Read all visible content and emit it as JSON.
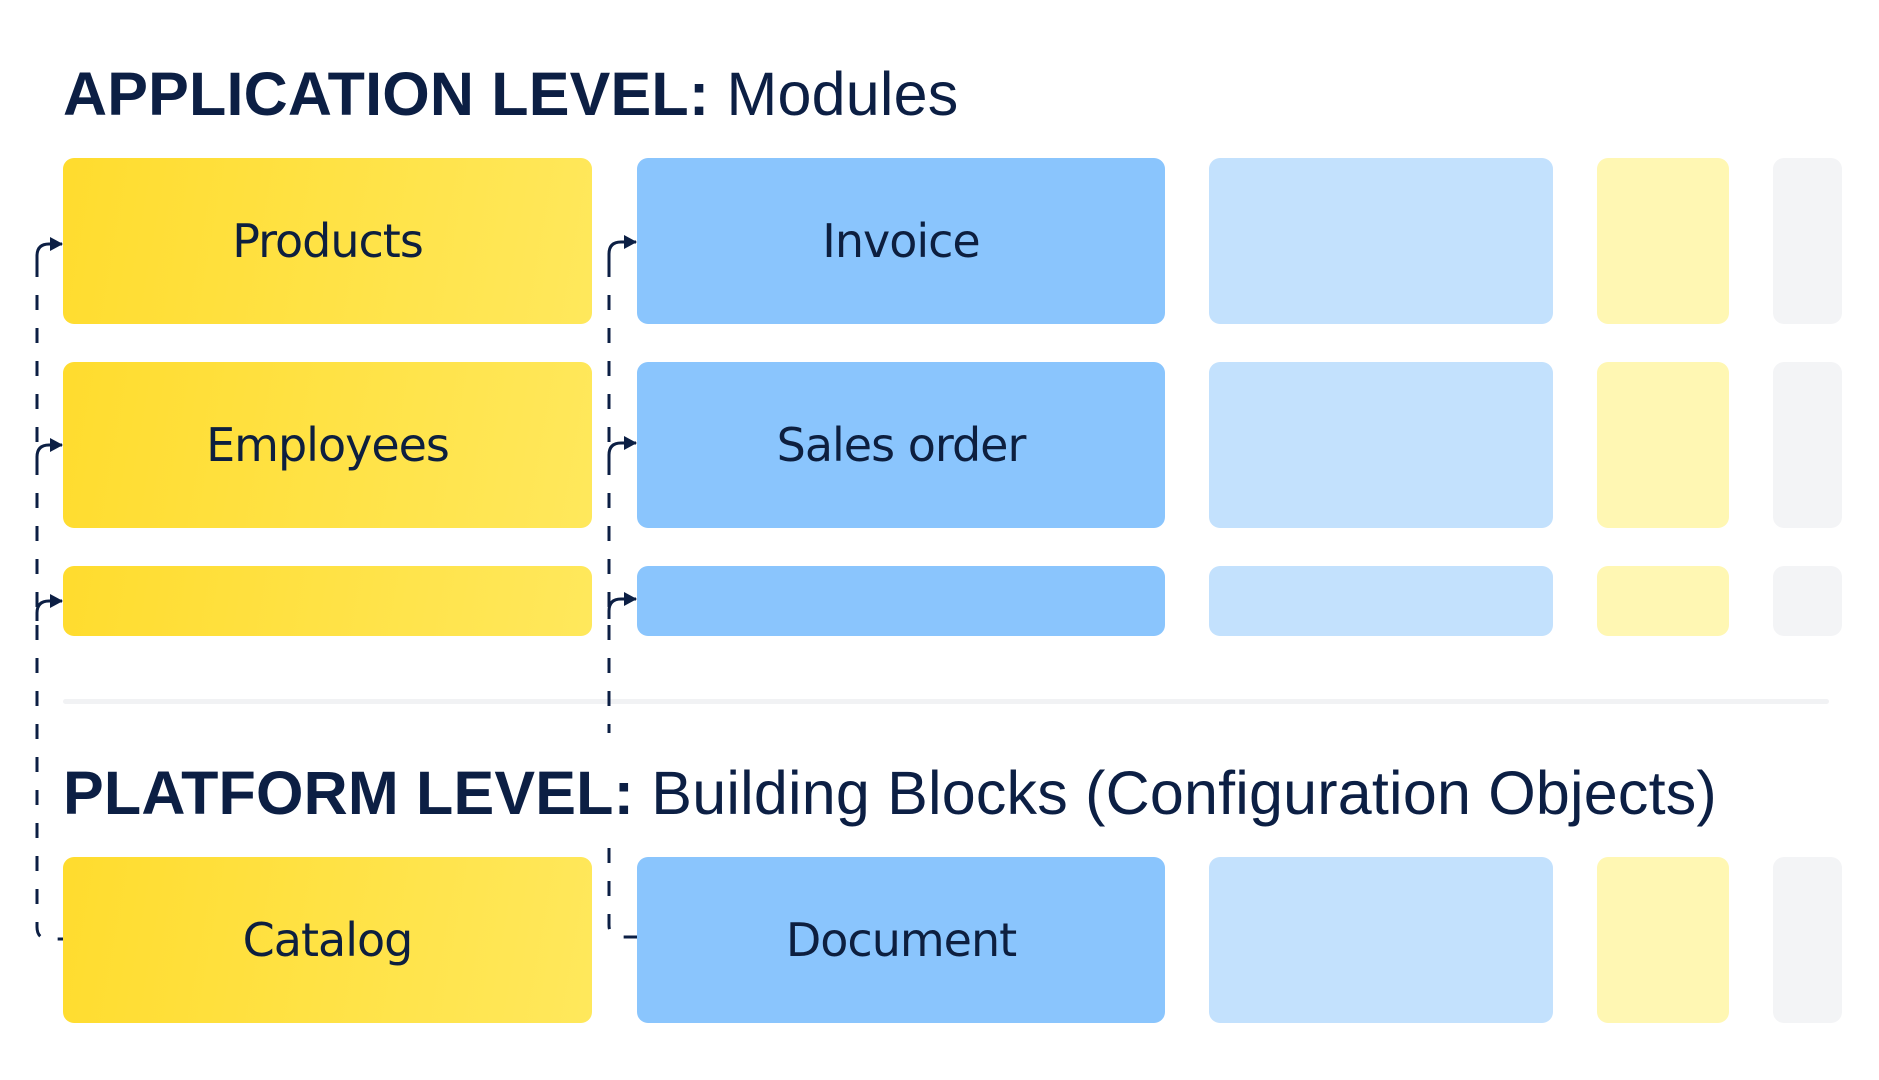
{
  "application_level": {
    "heading_strong": "APPLICATION LEVEL:",
    "heading_light": " Modules",
    "modules": {
      "products": "Products",
      "employees": "Employees",
      "invoice": "Invoice",
      "sales_order": "Sales order"
    }
  },
  "platform_level": {
    "heading_strong": "PLATFORM LEVEL:",
    "heading_light": " Building Blocks (Configuration Objects)",
    "blocks": {
      "catalog": "Catalog",
      "document": "Document"
    }
  },
  "colors": {
    "text": "#0c1f44",
    "catalog_family": "#ffdc2e",
    "document_family": "#8ac5fd",
    "family_3": "#c3e1fd",
    "family_4": "#fff7b3",
    "family_5": "#f3f4f6",
    "divider": "#f1f2f4"
  },
  "relations": [
    {
      "from": "Catalog",
      "to": [
        "Products",
        "Employees",
        "(unlabeled module)"
      ]
    },
    {
      "from": "Document",
      "to": [
        "Invoice",
        "Sales order",
        "(unlabeled module)"
      ]
    }
  ]
}
